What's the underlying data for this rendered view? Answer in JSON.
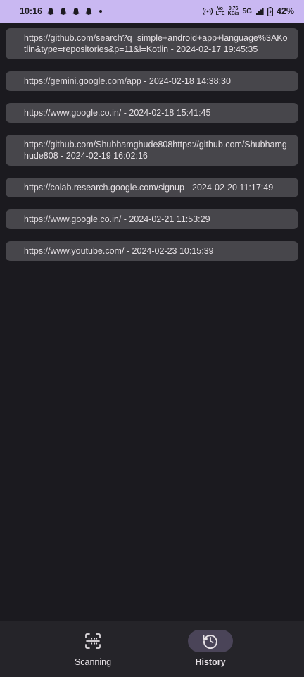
{
  "status_bar": {
    "time": "10:16",
    "speed_value": "0.76",
    "speed_unit": "KB/s",
    "network": "5G",
    "volte": "Vo LTE",
    "battery": "42%"
  },
  "history": [
    "https://github.com/search?q=simple+android+app+language%3AKotlin&type=repositories&p=11&l=Kotlin - 2024-02-17 19:45:35",
    "https://gemini.google.com/app - 2024-02-18 14:38:30",
    "https://www.google.co.in/ - 2024-02-18 15:41:45",
    "https://github.com/Shubhamghude808https://github.com/Shubhamghude808 - 2024-02-19 16:02:16",
    "https://colab.research.google.com/signup - 2024-02-20 11:17:49",
    "https://www.google.co.in/ - 2024-02-21 11:53:29",
    "https://www.youtube.com/ - 2024-02-23 10:15:39"
  ],
  "nav": {
    "scanning": {
      "label": "Scanning",
      "icon": "scan-icon"
    },
    "history": {
      "label": "History",
      "icon": "history-icon",
      "active": true
    }
  },
  "colors": {
    "status_bar": "#c9b8f2",
    "background": "#1b1a1f",
    "card": "#47464b",
    "nav_bar": "#252429",
    "active_pill": "#4a4458"
  }
}
